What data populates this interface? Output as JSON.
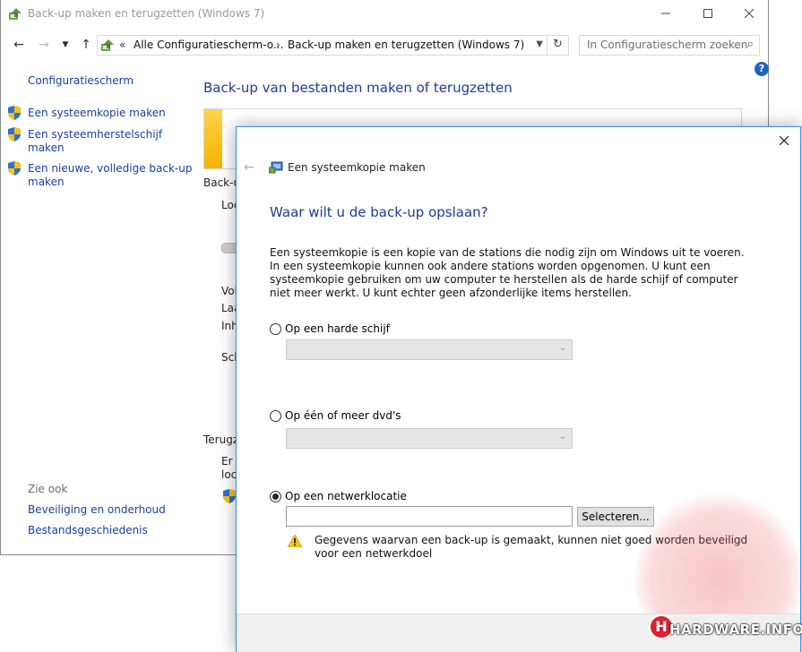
{
  "window": {
    "title": "Back-up maken en terugzetten (Windows 7)",
    "minimize_icon": "minimize-icon",
    "maximize_icon": "maximize-icon",
    "close_icon": "close-icon"
  },
  "navbar": {
    "address_prefix": "«",
    "breadcrumb": [
      "Alle Configuratiescherm-o...",
      "Back-up maken en terugzetten (Windows 7)"
    ],
    "search_placeholder": "In Configuratiescherm zoeken"
  },
  "sidebar": {
    "title": "Configuratiescherm",
    "links": [
      {
        "label": "Een systeemkopie maken"
      },
      {
        "label": "Een systeemherstelschijf",
        "label2": "maken"
      },
      {
        "label": "Een nieuwe, volledige back-up",
        "label2": "maken"
      }
    ],
    "see_also": "Zie ook",
    "see_also_links": [
      "Beveiliging en onderhoud",
      "Bestandsgeschiedenis"
    ]
  },
  "main": {
    "heading": "Back-up van bestanden maken of terugzetten",
    "clipped": [
      "Back-u",
      "Loc",
      "Vol",
      "Laa",
      "Inh",
      "Sch",
      "Terugz",
      "Er a",
      "loc"
    ]
  },
  "dialog": {
    "title": "Een systeemkopie maken",
    "heading": "Waar wilt u de back-up opslaan?",
    "description": "Een systeemkopie is een kopie van de stations die nodig zijn om Windows uit te voeren. In een systeemkopie kunnen ook andere stations worden opgenomen. U kunt een systeemkopie gebruiken om uw computer te herstellen als de harde schijf of computer niet meer werkt. U kunt echter geen afzonderlijke items herstellen.",
    "options": [
      {
        "label": "Op een harde schijf",
        "checked": false
      },
      {
        "label": "Op één of meer dvd's",
        "checked": false
      },
      {
        "label": "Op een netwerklocatie",
        "checked": true
      }
    ],
    "network_path_value": "",
    "select_button": "Selecteren...",
    "warning": "Gegevens waarvan een back-up is gemaakt, kunnen niet goed worden beveiligd voor een netwerkdoel"
  },
  "watermark": {
    "text": "HARDWARE.INFO",
    "letter": "H"
  },
  "colors": {
    "link": "#1a3fa5",
    "heading": "#1e3c96",
    "dialog_border": "#3c8be0",
    "accent_yellow": "#f4b400"
  }
}
